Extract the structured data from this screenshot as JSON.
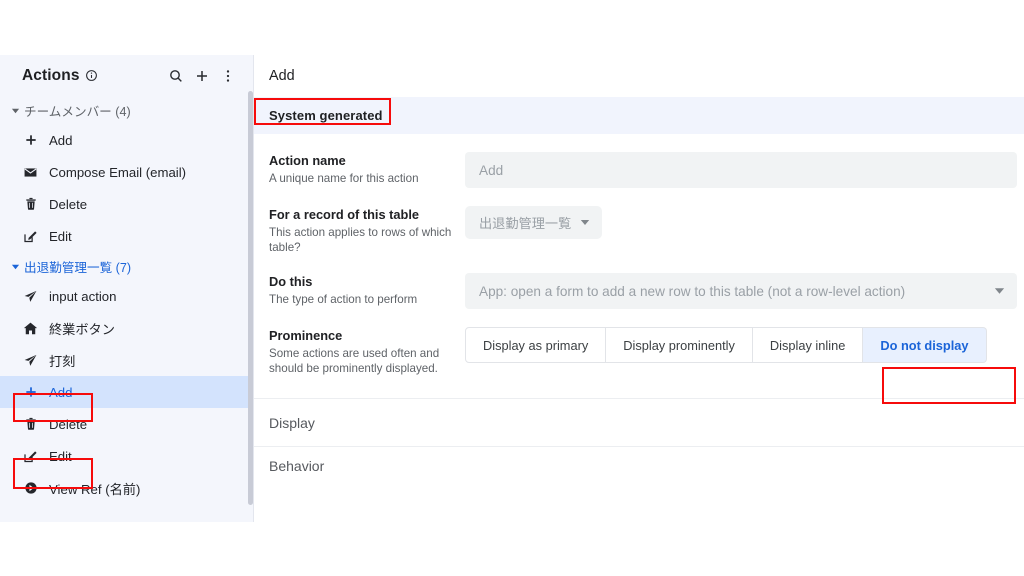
{
  "sidebar": {
    "title": "Actions",
    "info_icon": "info-circle-icon",
    "search_icon": "search-icon",
    "add_icon": "plus-icon",
    "more_icon": "more-vertical-icon",
    "groups": [
      {
        "label": "チームメンバー",
        "count": "(4)",
        "color": "#5f6368",
        "expanded": true,
        "items": [
          {
            "label": "Add",
            "icon": "plus-icon"
          },
          {
            "label": "Compose Email (email)",
            "icon": "envelope-icon"
          },
          {
            "label": "Delete",
            "icon": "trash-icon"
          },
          {
            "label": "Edit",
            "icon": "edit-pencil-square-icon"
          }
        ]
      },
      {
        "label": "出退勤管理一覧",
        "count": "(7)",
        "color": "#1b64d8",
        "expanded": true,
        "items": [
          {
            "label": "input action",
            "icon": "paper-plane-icon"
          },
          {
            "label": "終業ボタン",
            "icon": "home-icon"
          },
          {
            "label": "打刻",
            "icon": "paper-plane-icon"
          },
          {
            "label": "Add",
            "icon": "plus-icon",
            "selected": true,
            "annotated": true
          },
          {
            "label": "Delete",
            "icon": "trash-icon"
          },
          {
            "label": "Edit",
            "icon": "edit-pencil-square-icon",
            "annotated": true
          },
          {
            "label": "View Ref (名前)",
            "icon": "arrow-circle-right-icon"
          }
        ]
      }
    ]
  },
  "main": {
    "title": "Add",
    "banner": {
      "label": "System generated",
      "annotated": true,
      "background": "#f1f4fd"
    },
    "fields": [
      {
        "label": "Action name",
        "description": "A unique name for this action",
        "control": "text",
        "value": "",
        "placeholder": "Add"
      },
      {
        "label": "For a record of this table",
        "description": "This action applies to rows of which table?",
        "control": "pill-select",
        "value": "出退勤管理一覧",
        "caret": "chevron-down-icon"
      },
      {
        "label": "Do this",
        "description": "The type of action to perform",
        "control": "wide-select",
        "value": "App: open a form to add a new row to this table (not a row-level action)",
        "caret": "chevron-down-icon"
      },
      {
        "label": "Prominence",
        "description": "Some actions are used often and should be prominently displayed.",
        "control": "segmented",
        "options": [
          {
            "label": "Display as primary",
            "active": false
          },
          {
            "label": "Display prominently",
            "active": false
          },
          {
            "label": "Display inline",
            "active": false
          },
          {
            "label": "Do not display",
            "active": true,
            "annotated": true
          }
        ]
      }
    ],
    "sections": [
      {
        "label": "Display"
      },
      {
        "label": "Behavior",
        "clipped": true
      }
    ]
  },
  "theme": {
    "accent_blue": "#1b64d8",
    "selected_row_blue": "#d3e3fd",
    "segment_active_blue": "#e8f0fe",
    "annotation_red": "#f60b0b",
    "sidebar_bg": "#f4f6fc",
    "field_bg": "#f1f3f4",
    "muted_text": "#5f6368"
  }
}
